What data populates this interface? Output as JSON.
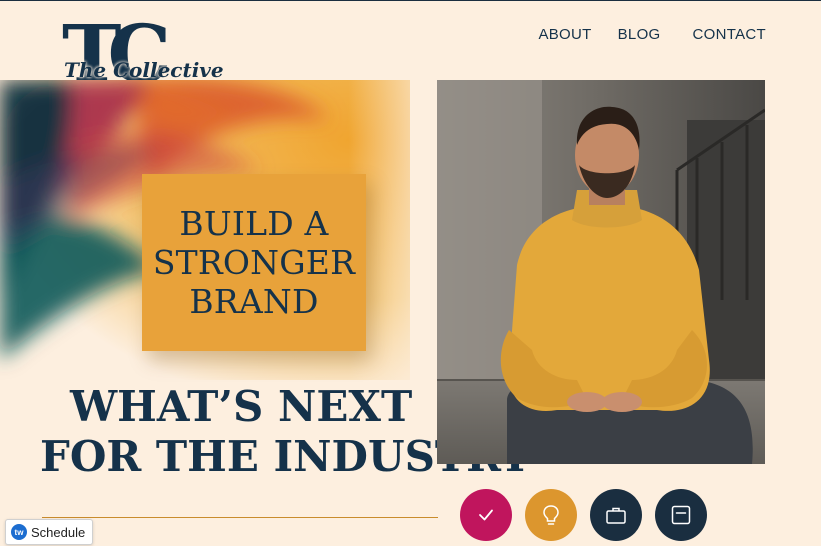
{
  "logo": {
    "monogram": "TC",
    "script": "The Collective"
  },
  "nav": {
    "items": [
      "ABOUT",
      "BLOG",
      "CONTACT"
    ]
  },
  "hero": {
    "brand_lines": [
      "BUILD A",
      "STRONGER",
      "BRAND"
    ],
    "headline_lines": [
      "WHAT’S NEXT",
      "FOR THE INDUSTRY"
    ]
  },
  "photo": {
    "subject": "man in mustard sweater sitting on concrete steps"
  },
  "actions": [
    {
      "icon": "check-icon",
      "color": "#c0155d"
    },
    {
      "icon": "lightbulb-icon",
      "color": "#dc962e"
    },
    {
      "icon": "briefcase-icon",
      "color": "#1a2e40"
    },
    {
      "icon": "card-icon",
      "color": "#1a2e40"
    }
  ],
  "widget": {
    "schedule_label": "Schedule",
    "icon_text": "tw"
  },
  "colors": {
    "navy": "#15324a",
    "mustard": "#e8a23a",
    "cream": "#fdefdf",
    "magenta": "#c0155d"
  }
}
